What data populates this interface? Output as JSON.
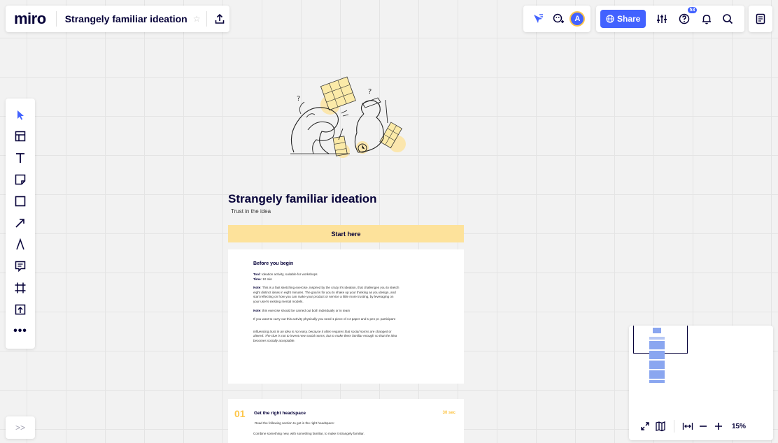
{
  "header": {
    "logo": "miro",
    "board_title": "Strangely familiar ideation",
    "share_label": "Share",
    "notifications_count": "53",
    "avatar_initial": "A"
  },
  "canvas": {
    "title": "Strangely familiar ideation",
    "subtitle": "Trust in the idea",
    "start_label": "Start here",
    "before": {
      "heading": "Before you begin",
      "tool_label": "Tool",
      "tool_value": ": Ideation activity, suitable for workshops",
      "time_label": "Time",
      "time_value": ": 10 min",
      "note1_label": "Note",
      "note1_value": ": This is a fast sketching exercise, inspired by the crazy 8's ideation, that challenges you to sketch eight distinct ideas in eight minutes. The goal is for you to shake up your thinking as you design, and start reflecting on how you can make your product or service a little more trusting, by leveraging on your user's existing mental models.",
      "note2_label": "Note",
      "note2_value": ": this exercise should be carried out both individually or in team",
      "materials": "If you want to carry out this activity physically you need 1 piece of A4 paper and 1 pen pr. participant",
      "quote": "Influencing trust in an idea is not easy, because it often requires that social norms are changed or altered. The clue is not to invent new social norms, but to make them familiar enough so that the idea becomes socially acceptable."
    },
    "step1": {
      "number": "01",
      "title": "Get the right headspace",
      "duration": "30 sec",
      "line1": "Read the following section to get in the right headspace:",
      "line2": "Combine something new, with something familiar, to make it strangely familiar."
    }
  },
  "toolbar": {
    "more_label": "•••",
    "expand_label": ">>"
  },
  "minimap": {
    "zoom_level": "15%"
  },
  "colors": {
    "accent_blue": "#4262ff",
    "highlight_yellow": "#fde29b",
    "number_yellow": "#fdc64a",
    "ink": "#050038"
  }
}
